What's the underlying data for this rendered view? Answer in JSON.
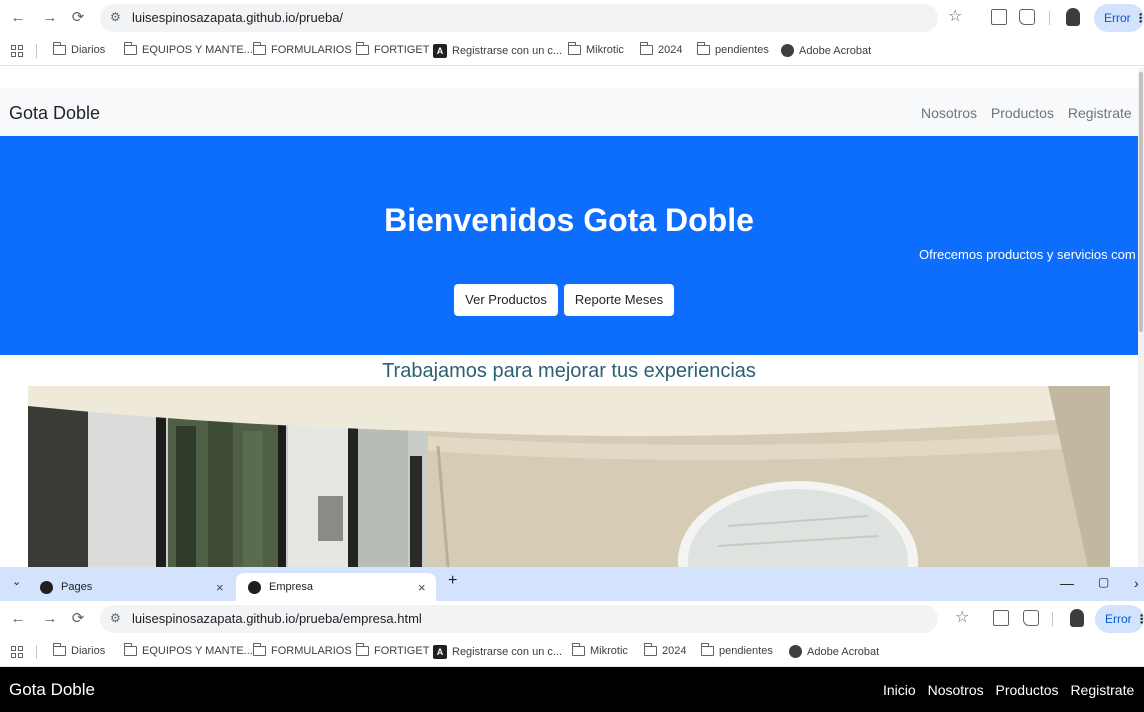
{
  "window1": {
    "url": "luisespinosazapata.github.io/prueba/",
    "profile_button": "Error",
    "bookmarks": [
      {
        "label": "Diarios",
        "icon": "folder-icon"
      },
      {
        "label": "EQUIPOS Y MANTE...",
        "icon": "folder-icon"
      },
      {
        "label": "FORMULARIOS",
        "icon": "folder-icon"
      },
      {
        "label": "FORTIGET",
        "icon": "folder-icon"
      },
      {
        "label": "Registrarse con un c...",
        "icon": "site-icon"
      },
      {
        "label": "Mikrotic",
        "icon": "folder-icon"
      },
      {
        "label": "2024",
        "icon": "folder-icon"
      },
      {
        "label": "pendientes",
        "icon": "folder-icon"
      },
      {
        "label": "Adobe Acrobat",
        "icon": "globe-icon"
      }
    ],
    "page": {
      "brand": "Gota Doble",
      "nav": [
        "Nosotros",
        "Productos",
        "Registrate"
      ],
      "hero_title": "Bienvenidos Gota Doble",
      "hero_side_text": "Ofrecemos productos y servicios com",
      "buttons": [
        "Ver Productos",
        "Reporte Meses"
      ],
      "subtitle": "Trabajamos para mejorar tus experiencias"
    }
  },
  "window2": {
    "tabs": [
      {
        "label": "Pages",
        "icon": "github-icon"
      },
      {
        "label": "Empresa",
        "icon": "globe-icon"
      }
    ],
    "new_tab": "+",
    "url": "luisespinosazapata.github.io/prueba/empresa.html",
    "profile_button": "Error",
    "page": {
      "brand": "Gota Doble",
      "nav": [
        "Inicio",
        "Nosotros",
        "Productos",
        "Registrate"
      ]
    }
  },
  "colors": {
    "hero_bg": "#0d6efd",
    "nav_light": "#f8f9fa",
    "nav_dark": "#000000",
    "tabstrip": "#d3e3fd"
  }
}
